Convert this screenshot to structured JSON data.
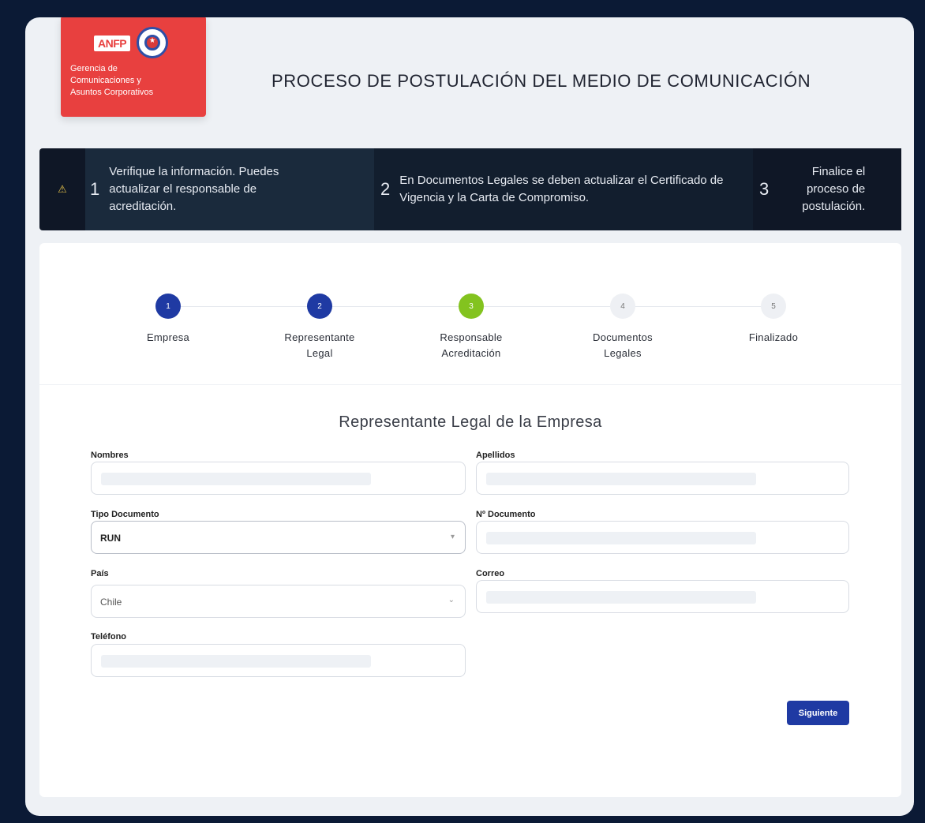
{
  "logo": {
    "brand": "ANFP",
    "lines": [
      "Gerencia de",
      "Comunicaciones y",
      "Asuntos Corporativos"
    ]
  },
  "header": {
    "title": "PROCESO DE POSTULACIÓN DEL MEDIO DE COMUNICACIÓN"
  },
  "info_bar": {
    "warning_icon": "warning-icon",
    "steps": [
      {
        "num": "1",
        "text": "Verifique la información. Puedes actualizar el responsable de acreditación."
      },
      {
        "num": "2",
        "text": "En Documentos Legales se deben actualizar el Certificado de Vigencia y la Carta de Compromiso."
      },
      {
        "num": "3",
        "text": "Finalice el proceso de postulación."
      }
    ]
  },
  "stepper": {
    "steps": [
      {
        "num": "1",
        "label": "Empresa",
        "state": "done"
      },
      {
        "num": "2",
        "label": "Representante Legal",
        "state": "current"
      },
      {
        "num": "3",
        "label": "Responsable Acreditación",
        "state": "next"
      },
      {
        "num": "4",
        "label": "Documentos Legales",
        "state": "pending"
      },
      {
        "num": "5",
        "label": "Finalizado",
        "state": "pending"
      }
    ]
  },
  "form": {
    "title": "Representante Legal de la Empresa",
    "fields": {
      "nombres": {
        "label": "Nombres",
        "value": ""
      },
      "apellidos": {
        "label": "Apellidos",
        "value": ""
      },
      "tipo_documento": {
        "label": "Tipo Documento",
        "value": "RUN"
      },
      "n_documento": {
        "label": "Nº Documento",
        "value": ""
      },
      "pais": {
        "label": "País",
        "value": "Chile"
      },
      "correo": {
        "label": "Correo",
        "value": ""
      },
      "telefono": {
        "label": "Teléfono",
        "value": ""
      }
    },
    "next_label": "Siguiente"
  },
  "colors": {
    "primary": "#1f3aa3",
    "accent_green": "#83c31f",
    "logo_red": "#e8403f",
    "info_bar_bg": "#0f1726"
  }
}
